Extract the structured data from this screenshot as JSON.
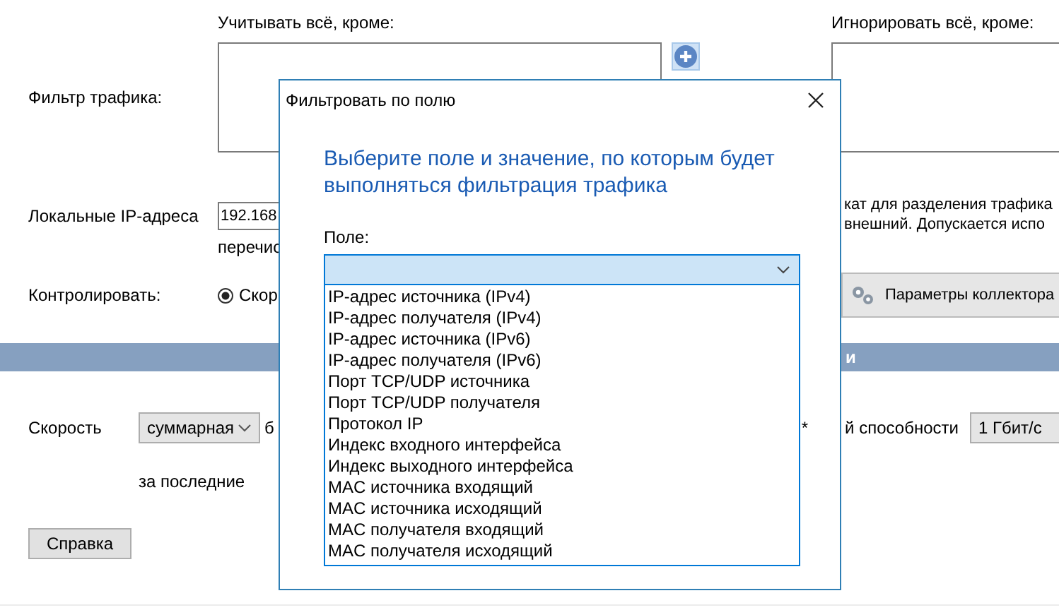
{
  "filter": {
    "label": "Фильтр трафика:",
    "include_label": "Учитывать всё, кроме:",
    "exclude_label": "Игнорировать всё, кроме:"
  },
  "local_ip": {
    "label": "Локальные IP-адреса",
    "value": "192.168",
    "hint": "перечис",
    "note_lines": [
      "кат для разделения трафика",
      "внешний. Допускается испо"
    ]
  },
  "monitor": {
    "label": "Контролировать:",
    "radio": {
      "label": "Скор",
      "selected": true
    },
    "collector_button": "Параметры коллектора"
  },
  "section_bar": {
    "title": "и"
  },
  "speed": {
    "label": "Скорость",
    "select": "суммарная",
    "after": "б",
    "asterisk": "*",
    "capacity_label": "й способности",
    "capacity_select": "1 Гбит/с",
    "period_label": "за последние"
  },
  "help_button": "Справка",
  "dialog": {
    "title": "Фильтровать по полю",
    "heading_lines": [
      "Выберите поле и значение, по которым будет",
      "выполняться фильтрация трафика"
    ],
    "field_label": "Поле:",
    "expanded": true,
    "options": [
      {
        "label": "IP-адрес источника (IPv4)"
      },
      {
        "label": "IP-адрес получателя (IPv4)"
      },
      {
        "label": "IP-адрес источника (IPv6)"
      },
      {
        "label": "IP-адрес получателя (IPv6)"
      },
      {
        "label": "Порт TCP/UDP источника"
      },
      {
        "label": "Порт TCP/UDP получателя"
      },
      {
        "label": "Протокол IP"
      },
      {
        "label": "Индекс входного интерфейса"
      },
      {
        "label": "Индекс выходного интерфейса"
      },
      {
        "label": "MAC источника входящий"
      },
      {
        "label": "MAC источника исходящий"
      },
      {
        "label": "MAC получателя входящий"
      },
      {
        "label": "MAC получателя исходящий"
      }
    ]
  }
}
